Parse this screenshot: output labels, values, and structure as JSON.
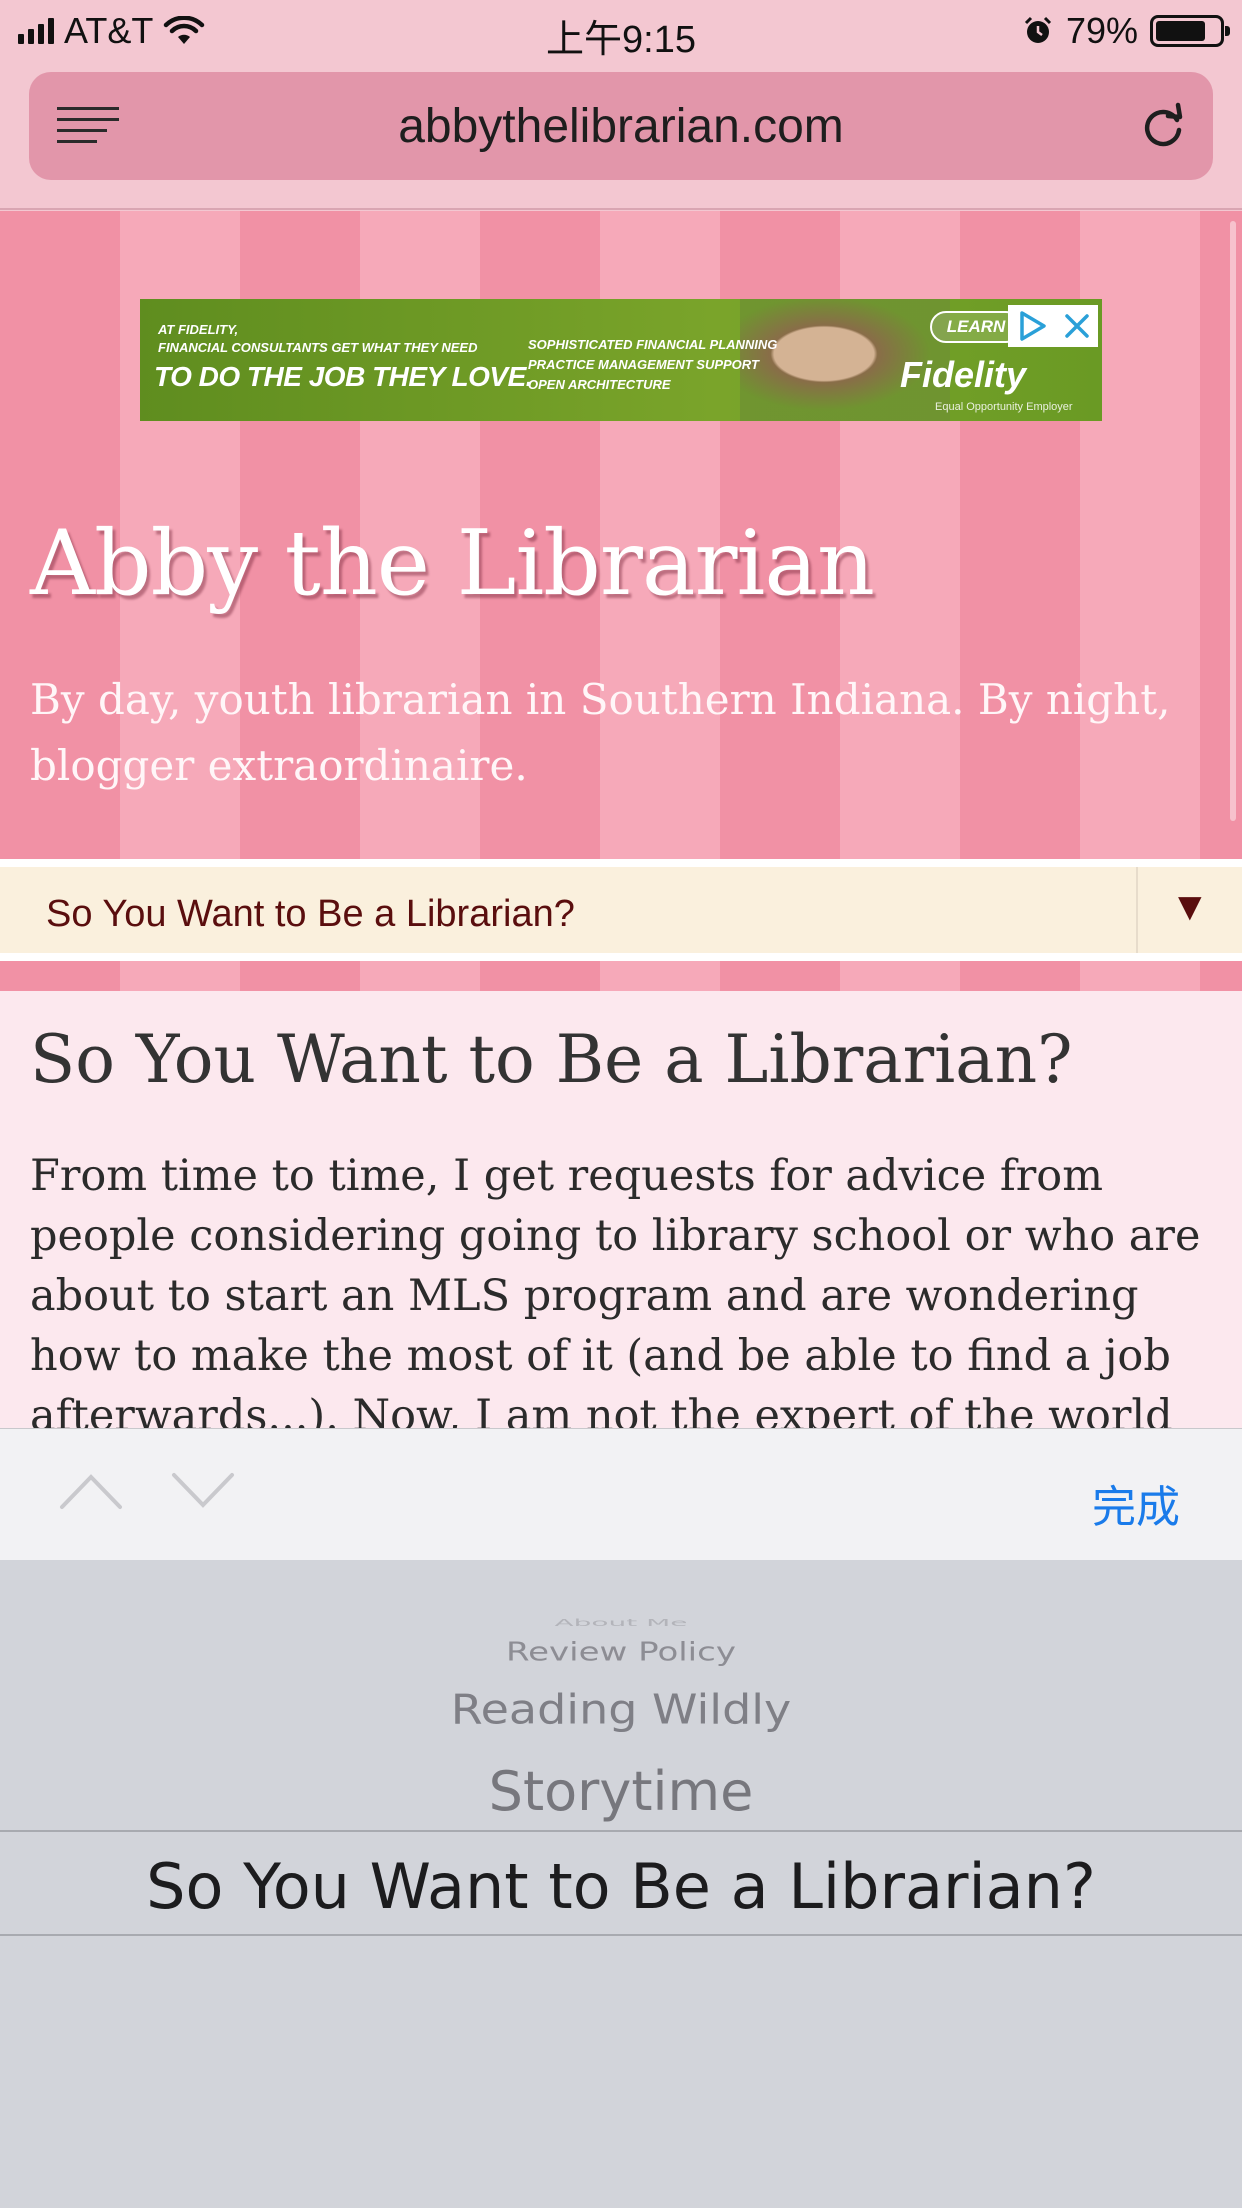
{
  "status_bar": {
    "carrier": "AT&T",
    "time": "上午9:15",
    "battery_percent": "79%",
    "battery_level": 0.79
  },
  "browser": {
    "url": "abbythelibrarian.com"
  },
  "ad": {
    "small_text_1": "AT FIDELITY,",
    "small_text_2": "FINANCIAL CONSULTANTS GET WHAT THEY NEED",
    "headline": "TO DO THE JOB THEY LOVE.",
    "bullet_1": "SOPHISTICATED FINANCIAL PLANNING",
    "bullet_2": "PRACTICE MANAGEMENT SUPPORT",
    "bullet_3": "OPEN ARCHITECTURE",
    "learn": "LEARN",
    "brand": "Fidelity",
    "footer": "Equal Opportunity Employer"
  },
  "site": {
    "title": "Abby the Librarian",
    "tagline": "By day, youth librarian in Southern Indiana. By night, blogger extraordinaire."
  },
  "nav": {
    "selected": "So You Want to Be a Librarian?",
    "arrow": "▼"
  },
  "post": {
    "title": "So You Want to Be a Librarian?",
    "body": "From time to time, I get requests for advice from people considering going to library school or who are about to start an MLS program and are wondering how to make the most of it (and be able to find a job afterwards...). Now, I am not the expert of the world on such things"
  },
  "toolbar": {
    "done_label": "完成"
  },
  "picker": {
    "items": [
      "About Me",
      "Review Policy",
      "Reading Wildly",
      "Storytime"
    ],
    "selected": "So You Want to Be a Librarian?"
  }
}
